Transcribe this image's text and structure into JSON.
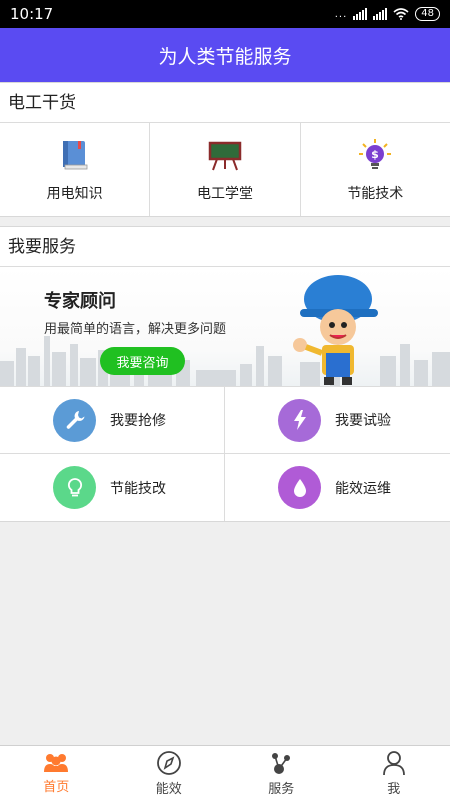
{
  "status_bar": {
    "time": "10:17",
    "dots": "...",
    "battery": "48"
  },
  "header": {
    "title": "为人类节能服务"
  },
  "electric_tips": {
    "title": "电工干货",
    "items": [
      {
        "label": "用电知识",
        "icon": "book-icon"
      },
      {
        "label": "电工学堂",
        "icon": "blackboard-icon"
      },
      {
        "label": "节能技术",
        "icon": "bulb-dollar-icon"
      }
    ]
  },
  "services": {
    "title": "我要服务",
    "banner": {
      "title": "专家顾问",
      "subtitle": "用最简单的语言，解决更多问题",
      "button": "我要咨询"
    },
    "items": [
      {
        "label": "我要抢修",
        "icon": "wrench-icon",
        "color": "#5b9bd6"
      },
      {
        "label": "我要试验",
        "icon": "lightning-icon",
        "color": "#a66ad8"
      },
      {
        "label": "节能技改",
        "icon": "lightbulb-icon",
        "color": "#5bd88a"
      },
      {
        "label": "能效运维",
        "icon": "drop-icon",
        "color": "#b05bd6"
      }
    ]
  },
  "bottom_nav": {
    "items": [
      {
        "label": "首页",
        "icon": "home-people-icon",
        "active": true
      },
      {
        "label": "能效",
        "icon": "compass-icon",
        "active": false
      },
      {
        "label": "服务",
        "icon": "share-node-icon",
        "active": false
      },
      {
        "label": "我",
        "icon": "person-icon",
        "active": false
      }
    ],
    "active_color": "#ff7a2f"
  },
  "colors": {
    "header_bg": "#5a4bf2",
    "consult_button": "#20c021"
  }
}
